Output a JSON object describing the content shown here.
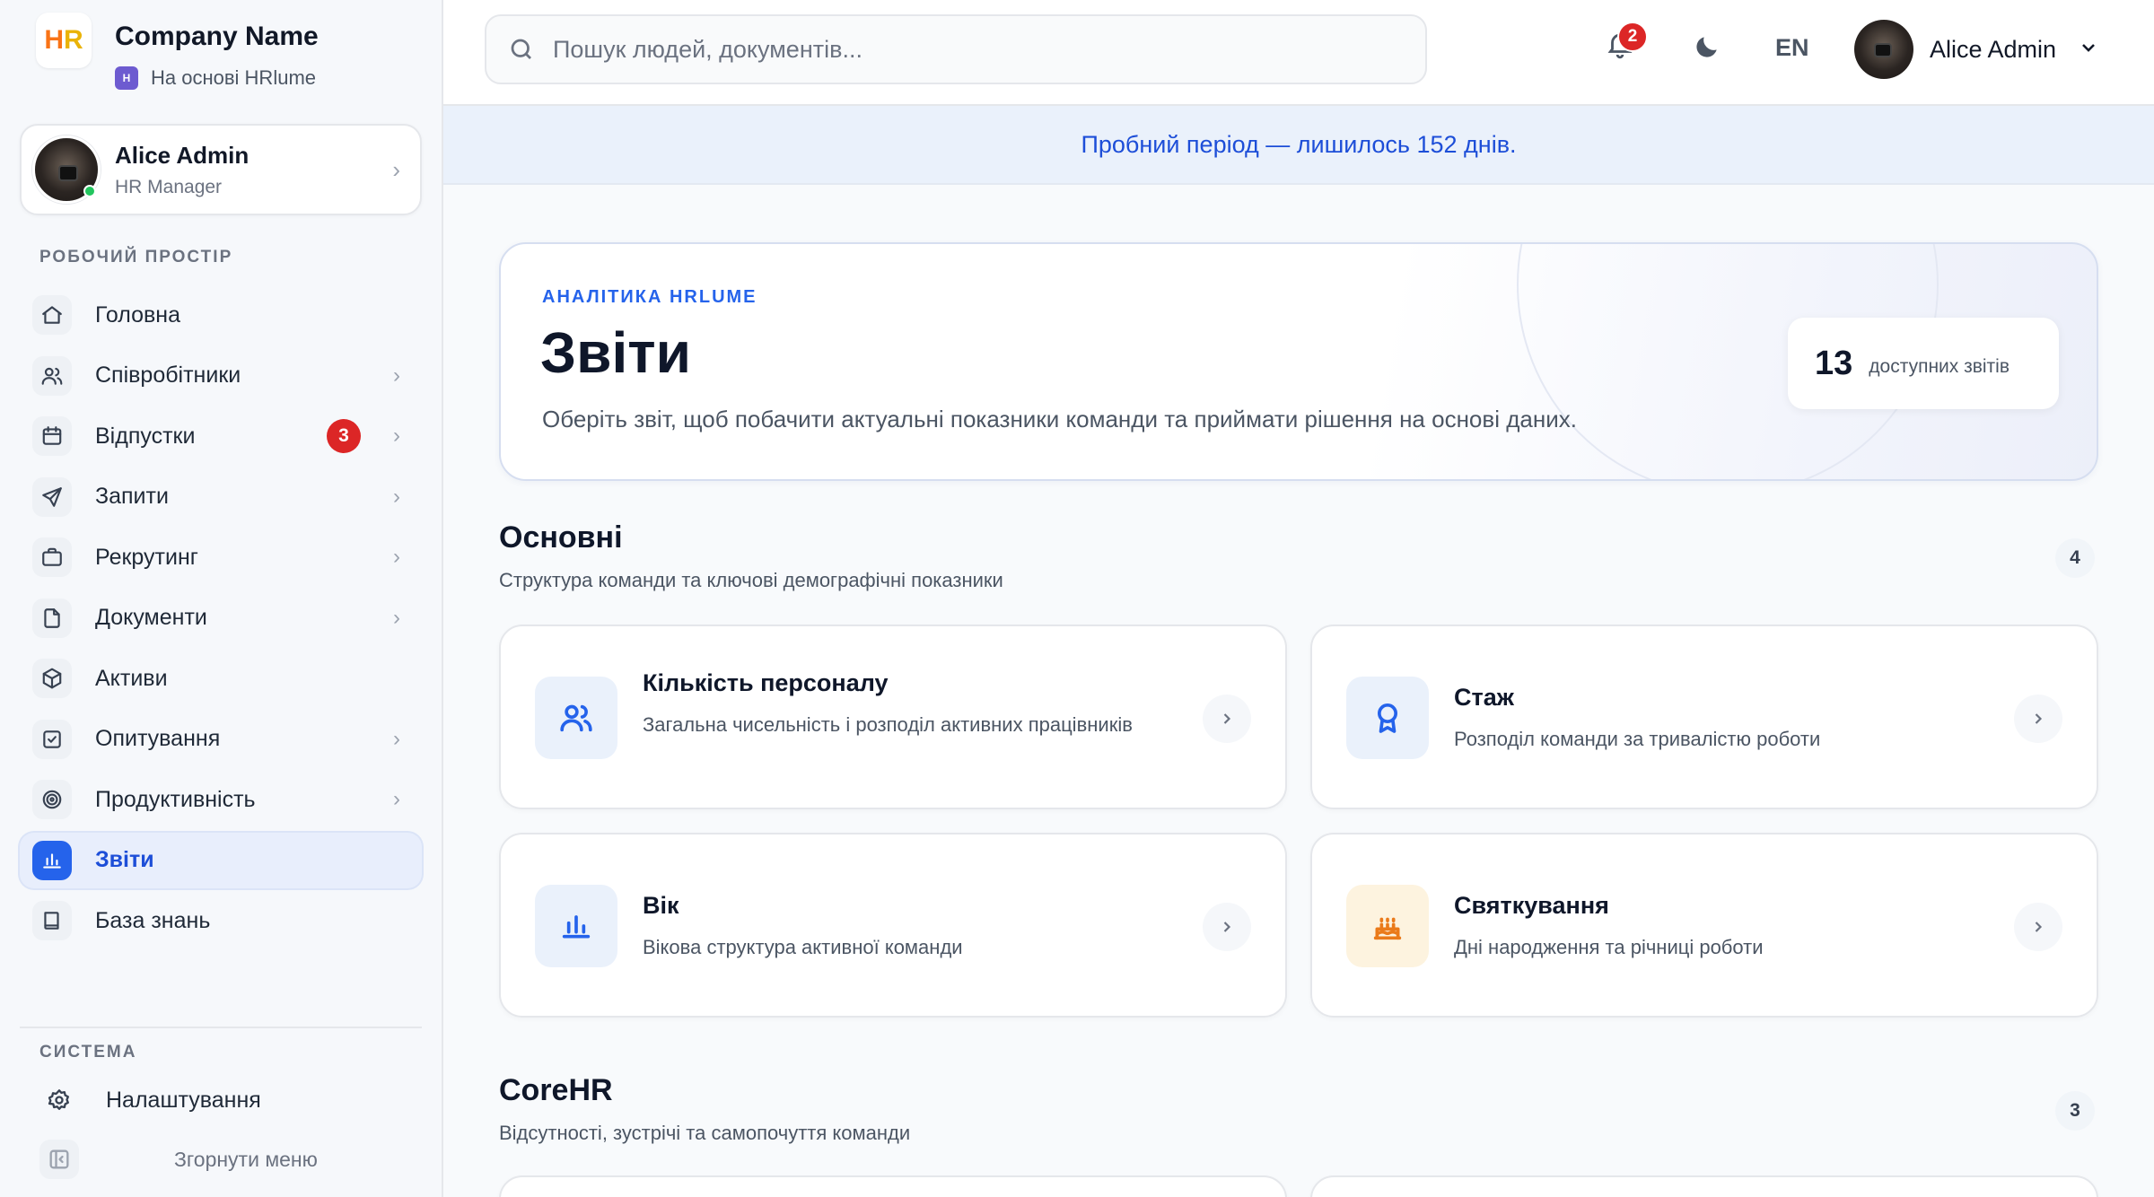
{
  "sidebar": {
    "company_name": "Company Name",
    "logo_text_h": "H",
    "logo_text_r": "R",
    "powered_by": "На основі HRlume",
    "profile": {
      "name": "Alice Admin",
      "role": "HR Manager"
    },
    "workspace_label": "РОБОЧИЙ ПРОСТІР",
    "items": [
      {
        "label": "Головна",
        "icon": "home-icon",
        "arrow": false
      },
      {
        "label": "Співробітники",
        "icon": "users-icon",
        "arrow": true
      },
      {
        "label": "Відпустки",
        "icon": "calendar-icon",
        "arrow": true,
        "badge": "3"
      },
      {
        "label": "Запити",
        "icon": "send-icon",
        "arrow": true
      },
      {
        "label": "Рекрутинг",
        "icon": "briefcase-icon",
        "arrow": true
      },
      {
        "label": "Документи",
        "icon": "file-icon",
        "arrow": true
      },
      {
        "label": "Активи",
        "icon": "box-icon",
        "arrow": false
      },
      {
        "label": "Опитування",
        "icon": "checkbox-icon",
        "arrow": true
      },
      {
        "label": "Продуктивність",
        "icon": "target-icon",
        "arrow": true
      },
      {
        "label": "Звіти",
        "icon": "bar-chart-icon",
        "arrow": false,
        "active": true
      },
      {
        "label": "База знань",
        "icon": "book-icon",
        "arrow": false
      }
    ],
    "system_label": "СИСТЕМА",
    "settings_label": "Налаштування",
    "collapse_label": "Згорнути меню"
  },
  "topbar": {
    "search_placeholder": "Пошук людей, документів...",
    "notifications_count": "2",
    "language": "EN",
    "user_name": "Alice Admin"
  },
  "trial_banner": "Пробний період — лишилось 152 днів.",
  "hero": {
    "eyebrow": "АНАЛІТИКА HRLUME",
    "title": "Звіти",
    "description": "Оберіть звіт, щоб побачити актуальні показники команди та приймати рішення на основі даних.",
    "stat_number": "13",
    "stat_label": "доступних звітів"
  },
  "sections": [
    {
      "title": "Основні",
      "subtitle": "Структура команди та ключові демографічні показники",
      "count": "4",
      "cards": [
        {
          "title": "Кількість персоналу",
          "description": "Загальна чисельність і розподіл активних працівників",
          "icon": "users-icon"
        },
        {
          "title": "Стаж",
          "description": "Розподіл команди за тривалістю роботи",
          "icon": "award-icon"
        },
        {
          "title": "Вік",
          "description": "Вікова структура активної команди",
          "icon": "bar-chart-icon"
        },
        {
          "title": "Святкування",
          "description": "Дні народження та річниці роботи",
          "icon": "cake-icon"
        }
      ]
    },
    {
      "title": "CoreHR",
      "subtitle": "Відсутності, зустрічі та самопочуття команди",
      "count": "3"
    }
  ],
  "colors": {
    "accent": "#2563eb",
    "badge": "#dc2626",
    "warm_icon": "#ea7a1a"
  }
}
